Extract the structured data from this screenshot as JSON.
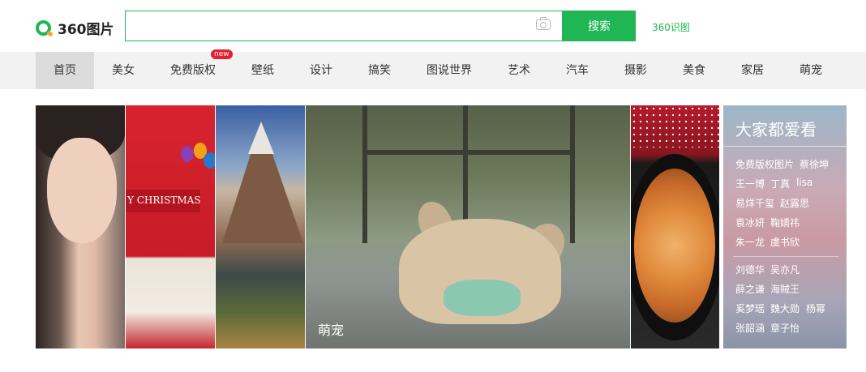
{
  "header": {
    "logo_text": "360图片",
    "search": {
      "value": "",
      "placeholder": ""
    },
    "search_button": "搜索",
    "shitu_link": "360识图"
  },
  "nav": {
    "items": [
      "首页",
      "美女",
      "免费版权",
      "壁纸",
      "设计",
      "搞笑",
      "图说世界",
      "艺术",
      "汽车",
      "摄影",
      "美食",
      "家居",
      "萌宠"
    ],
    "active_index": 0,
    "badge": "new"
  },
  "gallery": {
    "tiles": [
      {
        "icon": "portrait-woman-image"
      },
      {
        "icon": "christmas-image",
        "text": "Y CHRISTMAS"
      },
      {
        "icon": "mountain-landscape-image"
      },
      {
        "icon": "bulldog-mask-image",
        "label": "萌宠"
      },
      {
        "icon": "food-bowl-image"
      }
    ]
  },
  "panel": {
    "title": "大家都爱看",
    "tags": [
      [
        "免费版权图片",
        "蔡徐坤"
      ],
      [
        "王一博",
        "丁真",
        "lisa"
      ],
      [
        "易烊千玺",
        "赵露思"
      ],
      [
        "袁冰妍",
        "鞠婧祎"
      ],
      [
        "朱一龙",
        "虞书欣"
      ],
      [
        "刘德华",
        "吴亦凡"
      ],
      [
        "薛之谦",
        "海贼王"
      ],
      [
        "奚梦瑶",
        "魏大勋",
        "杨幂"
      ],
      [
        "张韶涵",
        "章子怡"
      ]
    ]
  },
  "colors": {
    "brand_green": "#1fb653",
    "nav_bg": "#f2f2f2",
    "badge_red": "#e5212f"
  }
}
